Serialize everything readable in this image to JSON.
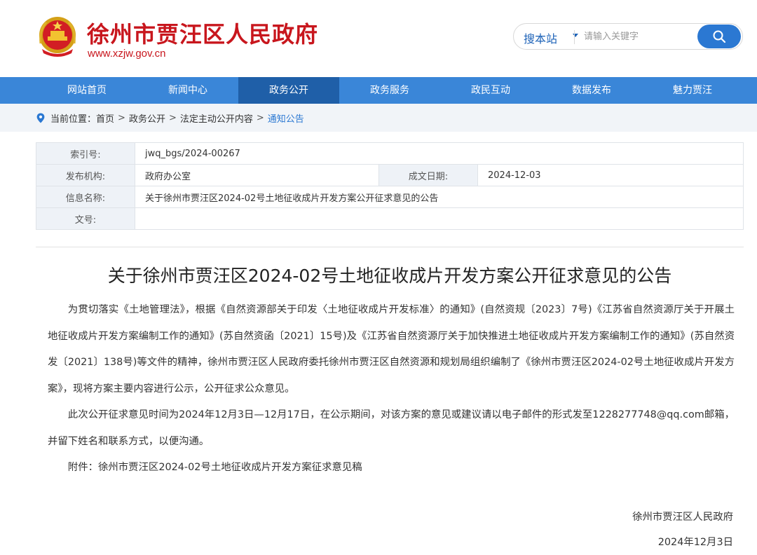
{
  "header": {
    "site_title": "徐州市贾汪区人民政府",
    "site_url": "www.xzjw.gov.cn",
    "emblem_icon": "national-emblem-icon"
  },
  "search": {
    "scope_label": "搜本站",
    "placeholder": "请输入关键字",
    "button_icon": "search-icon"
  },
  "nav": {
    "items": [
      {
        "label": "网站首页"
      },
      {
        "label": "新闻中心"
      },
      {
        "label": "政务公开"
      },
      {
        "label": "政务服务"
      },
      {
        "label": "政民互动"
      },
      {
        "label": "数据发布"
      },
      {
        "label": "魅力贾汪"
      }
    ],
    "active_index": 2
  },
  "breadcrumb": {
    "prefix": "当前位置：",
    "items": [
      "首页",
      "政务公开",
      "法定主动公开内容",
      "通知公告"
    ],
    "separator": ">"
  },
  "meta": {
    "index_label": "索引号:",
    "index_value": "jwq_bgs/2024-00267",
    "org_label": "发布机构:",
    "org_value": "政府办公室",
    "date_label": "成文日期:",
    "date_value": "2024-12-03",
    "name_label": "信息名称:",
    "name_value": "关于徐州市贾汪区2024-02号土地征收成片开发方案公开征求意见的公告",
    "doc_label": "文号:",
    "doc_value": ""
  },
  "article": {
    "title": "关于徐州市贾汪区2024-02号土地征收成片开发方案公开征求意见的公告",
    "paragraphs": [
      "为贯切落实《土地管理法》，根据《自然资源部关于印发〈土地征收成片开发标准〉的通知》(自然资规〔2023〕7号)《江苏省自然资源厅关于开展土地征收成片开发方案编制工作的通知》(苏自然资函〔2021〕15号)及《江苏省自然资源厅关于加快推进土地征收成片开发方案编制工作的通知》(苏自然资发〔2021〕138号)等文件的精神，徐州市贾汪区人民政府委托徐州市贾汪区自然资源和规划局组织编制了《徐州市贾汪区2024-02号土地征收成片开发方案》，现将方案主要内容进行公示，公开征求公众意见。",
      "此次公开征求意见时间为2024年12月3日—12月17日，在公示期间，对该方案的意见或建议请以电子邮件的形式发至1228277748@qq.com邮箱，并留下姓名和联系方式，以便沟通。",
      "附件：徐州市贾汪区2024-02号土地征收成片开发方案征求意见稿"
    ],
    "signature": "徐州市贾汪区人民政府",
    "date": "2024年12月3日"
  },
  "colors": {
    "brand_red": "#c8161d",
    "nav_blue": "#3a86d8",
    "nav_active": "#1f5fa8",
    "link_blue": "#2b78d2"
  }
}
